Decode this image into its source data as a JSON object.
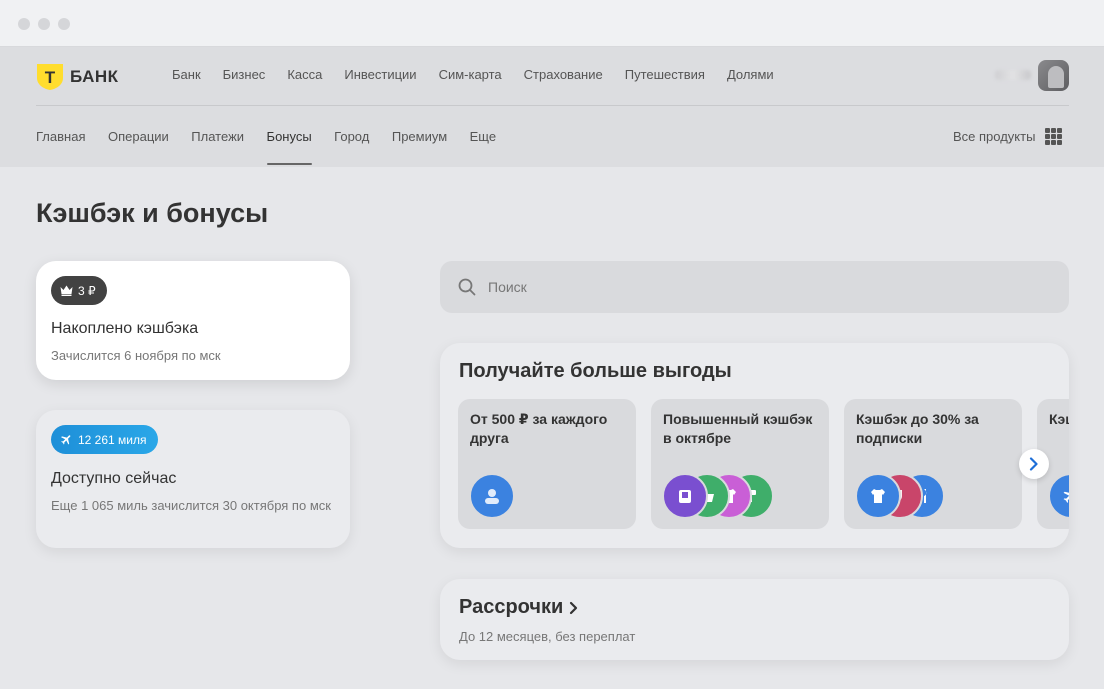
{
  "brand": {
    "logo_letter": "Т",
    "name": "БАНК"
  },
  "top_nav": [
    "Банк",
    "Бизнес",
    "Касса",
    "Инвестиции",
    "Сим-карта",
    "Страхование",
    "Путешествия",
    "Долями"
  ],
  "sub_nav": {
    "items": [
      "Главная",
      "Операции",
      "Платежи",
      "Бонусы",
      "Город",
      "Премиум",
      "Еще"
    ],
    "active": "Бонусы",
    "all_products": "Все продукты"
  },
  "page": {
    "title": "Кэшбэк и бонусы"
  },
  "cashback_card": {
    "badge": "3 ₽",
    "title": "Накоплено кэшбэка",
    "subtitle": "Зачислится 6 ноября по мск"
  },
  "miles_card": {
    "badge": "12 261 миля",
    "title": "Доступно сейчас",
    "subtitle": "Еще 1 065 миль зачислится 30 октября по мск"
  },
  "search": {
    "placeholder": "Поиск"
  },
  "benefits": {
    "title": "Получайте больше выгоды",
    "offers": [
      {
        "text": "От 500 ₽ за каждого друга"
      },
      {
        "text": "Повышенный кэшбэк в октябре"
      },
      {
        "text": "Кэшбэк до 30% за подписки"
      },
      {
        "text": "Кэшбэк за перелеты"
      }
    ]
  },
  "installments": {
    "title": "Рассрочки",
    "subtitle": "До 12 месяцев, без переплат"
  },
  "colors": {
    "brand_yellow": "#ffdd2d",
    "miles_blue": "#1e8fd8",
    "icon_blue": "#3b82e0",
    "icon_purple": "#7a4fd0",
    "icon_green": "#3fae6a",
    "icon_pink": "#c95fd6",
    "icon_red": "#c9456a"
  }
}
